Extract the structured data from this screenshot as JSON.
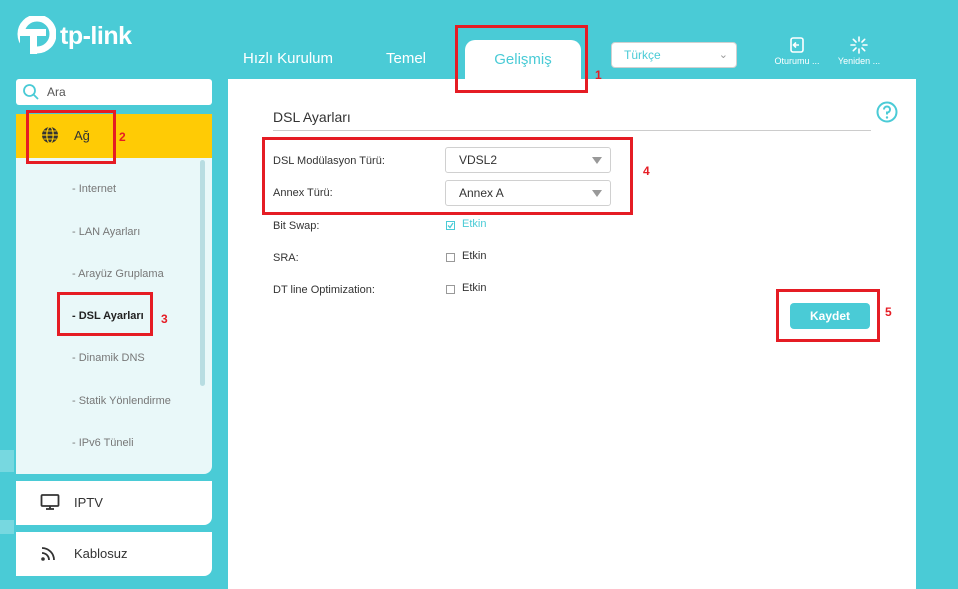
{
  "brand": {
    "name": "tp-link"
  },
  "nav": {
    "tabs": [
      {
        "label": "Hızlı Kurulum"
      },
      {
        "label": "Temel"
      },
      {
        "label": "Gelişmiş"
      }
    ],
    "language": "Türkçe",
    "logout_label": "Oturumu ...",
    "reboot_label": "Yeniden ..."
  },
  "search": {
    "placeholder": "Ara"
  },
  "sidebar": {
    "active_section": "Ağ",
    "subitems": [
      {
        "label": "- Internet"
      },
      {
        "label": "- LAN Ayarları"
      },
      {
        "label": "- Arayüz Gruplama"
      },
      {
        "label": "- DSL Ayarları"
      },
      {
        "label": "- Dinamik DNS"
      },
      {
        "label": "- Statik Yönlendirme"
      },
      {
        "label": "- IPv6 Tüneli"
      }
    ],
    "items": [
      {
        "label": "IPTV"
      },
      {
        "label": "Kablosuz"
      }
    ]
  },
  "content": {
    "section_title": "DSL Ayarları",
    "fields": {
      "modulation_label": "DSL Modülasyon Türü:",
      "modulation_value": "VDSL2",
      "annex_label": "Annex Türü:",
      "annex_value": "Annex A",
      "bitswap_label": "Bit Swap:",
      "bitswap_option": "Etkin",
      "bitswap_checked": true,
      "sra_label": "SRA:",
      "sra_option": "Etkin",
      "sra_checked": false,
      "dtline_label": "DT line Optimization:",
      "dtline_option": "Etkin",
      "dtline_checked": false
    },
    "save_label": "Kaydet"
  },
  "annotations": [
    "1",
    "2",
    "3",
    "4",
    "5"
  ],
  "colors": {
    "accent": "#4acbd6",
    "active_section": "#ffcb05",
    "annotation": "#e51c24"
  }
}
